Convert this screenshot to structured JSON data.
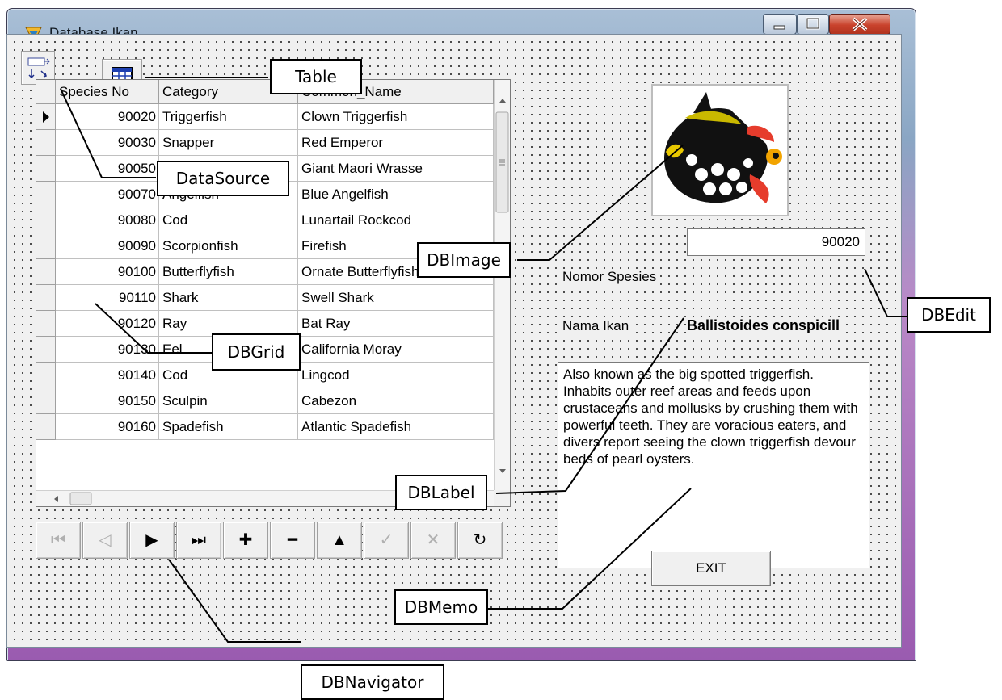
{
  "window": {
    "title": "Database Ikan"
  },
  "grid": {
    "columns": [
      "Species No",
      "Category",
      "Common_Name"
    ],
    "rows": [
      [
        "90020",
        "Triggerfish",
        "Clown Triggerfish"
      ],
      [
        "90030",
        "Snapper",
        "Red Emperor"
      ],
      [
        "90050",
        "Wrasse",
        "Giant Maori Wrasse"
      ],
      [
        "90070",
        "Angelfish",
        "Blue Angelfish"
      ],
      [
        "90080",
        "Cod",
        "Lunartail Rockcod"
      ],
      [
        "90090",
        "Scorpionfish",
        "Firefish"
      ],
      [
        "90100",
        "Butterflyfish",
        "Ornate Butterflyfish"
      ],
      [
        "90110",
        "Shark",
        "Swell Shark"
      ],
      [
        "90120",
        "Ray",
        "Bat Ray"
      ],
      [
        "90130",
        "Eel",
        "California Moray"
      ],
      [
        "90140",
        "Cod",
        "Lingcod"
      ],
      [
        "90150",
        "Sculpin",
        "Cabezon"
      ],
      [
        "90160",
        "Spadefish",
        "Atlantic Spadefish"
      ]
    ],
    "current_row": 0
  },
  "navigator": {
    "buttons": [
      {
        "name": "first",
        "glyph": "⏮",
        "enabled": false
      },
      {
        "name": "prior",
        "glyph": "◁",
        "enabled": false
      },
      {
        "name": "next",
        "glyph": "▶",
        "enabled": true
      },
      {
        "name": "last",
        "glyph": "⏭",
        "enabled": true
      },
      {
        "name": "insert",
        "glyph": "✚",
        "enabled": true
      },
      {
        "name": "delete",
        "glyph": "━",
        "enabled": true
      },
      {
        "name": "edit",
        "glyph": "▲",
        "enabled": true
      },
      {
        "name": "post",
        "glyph": "✓",
        "enabled": false
      },
      {
        "name": "cancel",
        "glyph": "✕",
        "enabled": false
      },
      {
        "name": "refresh",
        "glyph": "↻",
        "enabled": true
      }
    ]
  },
  "fields": {
    "species_label": "Nomor Spesies",
    "species_value": "90020",
    "name_label": "Nama Ikan",
    "name_value": "Ballistoides conspicill",
    "memo": "Also known as the big spotted triggerfish.  Inhabits outer reef areas and feeds upon crustaceans and mollusks by crushing them with powerful teeth.  They are voracious eaters, and divers report seeing the clown triggerfish devour beds of pearl oysters."
  },
  "exit_label": "EXIT",
  "callouts": {
    "table": "Table",
    "datasource": "DataSource",
    "dbimage": "DBImage",
    "dbedit": "DBEdit",
    "dbgrid": "DBGrid",
    "dblabel": "DBLabel",
    "dbmemo": "DBMemo",
    "dbnavigator": "DBNavigator"
  },
  "icons": {
    "app": "delphi-icon",
    "datasource": "datasource-component-icon",
    "table": "table-component-icon"
  }
}
